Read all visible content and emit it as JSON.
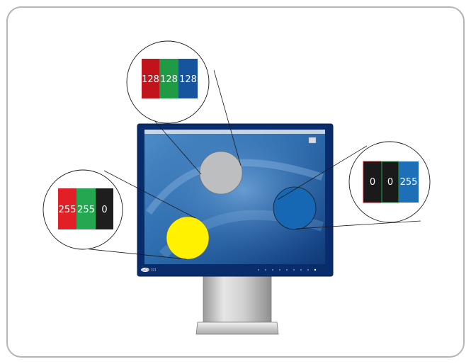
{
  "diagram": {
    "callouts": {
      "gray": {
        "values": [
          "128",
          "128",
          "128"
        ],
        "cell_colors": [
          "#c0131c",
          "#1f9a45",
          "#16549e"
        ],
        "spot_color": "#bdbec0"
      },
      "blue": {
        "values": [
          "0",
          "0",
          "255"
        ],
        "cell_colors": [
          "#1a1a1a",
          "#1a1a1a",
          "#1d6fb8"
        ],
        "spot_color": "#1668b5"
      },
      "yellow": {
        "values": [
          "255",
          "255",
          "0"
        ],
        "cell_colors": [
          "#e21f26",
          "#25a650",
          "#1e1e1e"
        ],
        "spot_color": "#fff100"
      }
    },
    "monitor": {
      "bezel_color": "#0b2c6b",
      "screen_color": "#1d5a9e",
      "brand_label": "LaCie",
      "model_label": "321"
    },
    "frame_border_color": "#b5b5b5"
  }
}
